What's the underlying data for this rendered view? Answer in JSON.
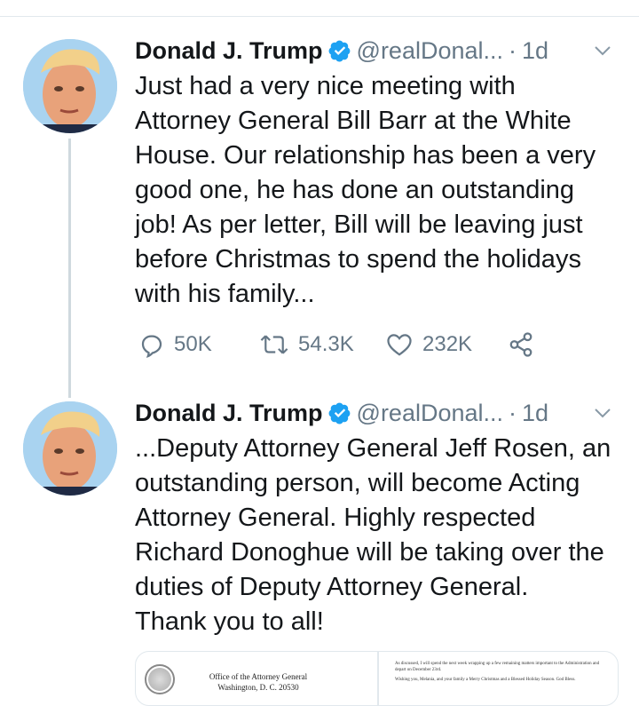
{
  "tweets": [
    {
      "name": "Donald J. Trump",
      "handle": "@realDonal...",
      "separator": "·",
      "time": "1d",
      "text": "Just had a very nice meeting with\nAttorney General Bill Barr at the White\nHouse. Our relationship has been a very\ngood one, he has done an outstanding\njob! As per letter, Bill will be leaving just\nbefore Christmas to spend the holidays\nwith his family...",
      "replies": "50K",
      "retweets": "54.3K",
      "likes": "232K"
    },
    {
      "name": "Donald J. Trump",
      "handle": "@realDonal...",
      "separator": "·",
      "time": "1d",
      "text": "...Deputy Attorney General Jeff Rosen, an\noutstanding person, will become Acting\nAttorney General. Highly respected\nRichard Donoghue will be taking over the\nduties of Deputy Attorney General.\nThank you to all!"
    }
  ],
  "media": {
    "letterhead_line1": "Office of the Attorney General",
    "letterhead_line2": "Washington, D. C. 20530",
    "letter_text_1": "As discussed, I will spend the next week wrapping up a few remaining matters important to the Administration and depart on December 23rd.",
    "letter_text_2": "Wishing you, Melania, and your family a Merry Christmas and a Blessed Holiday Season. God Bless."
  },
  "colors": {
    "verified": "#1da1f2",
    "secondary_text": "#657786",
    "thread_line": "#cfd9de"
  },
  "icons": [
    "verified-badge-icon",
    "chevron-down-icon",
    "reply-icon",
    "retweet-icon",
    "like-icon",
    "share-icon"
  ]
}
